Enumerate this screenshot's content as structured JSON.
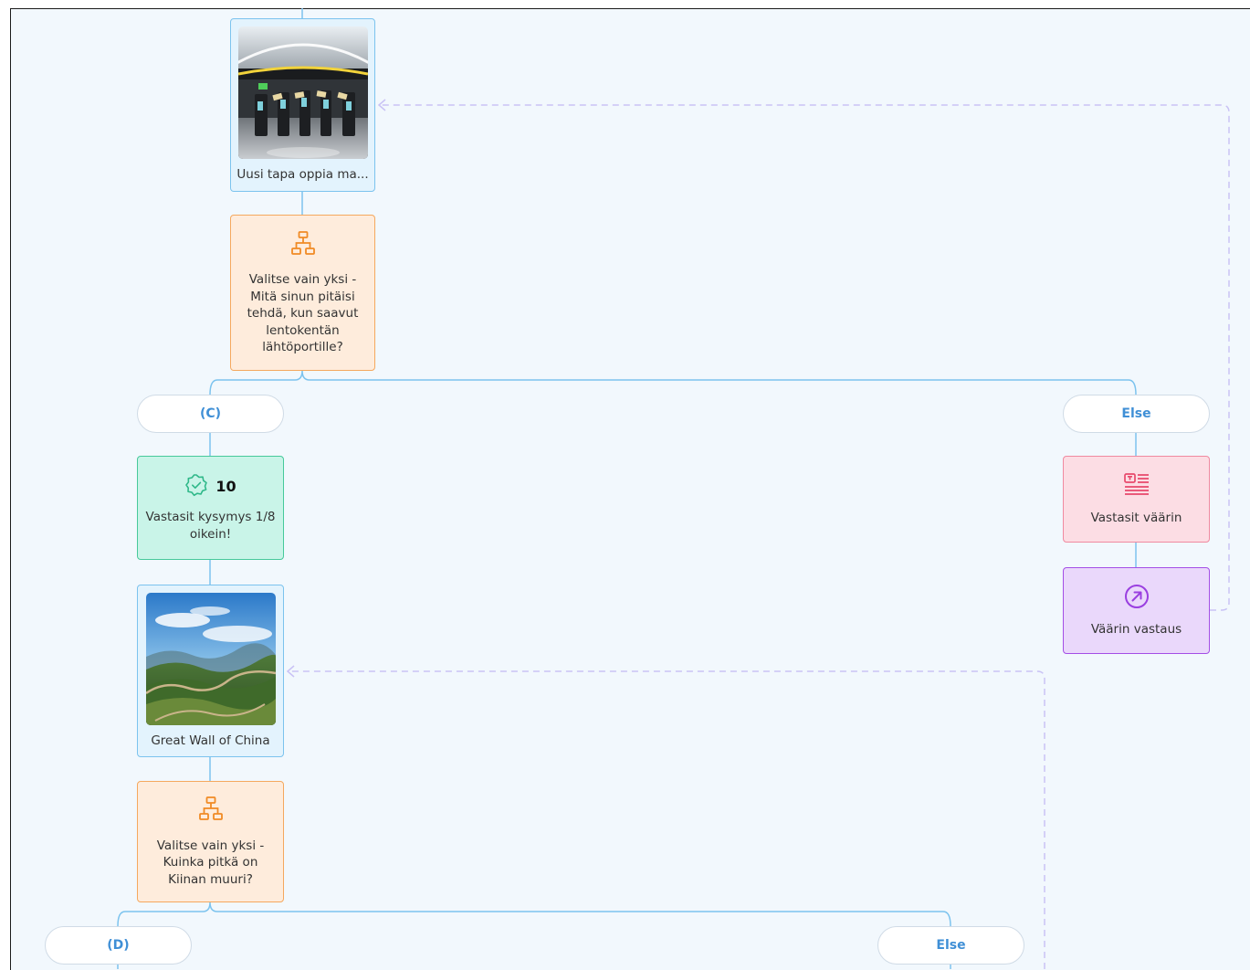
{
  "nodes": {
    "media_1": {
      "label": "Uusi tapa oppia ma...",
      "image": "airport gates with boarding kiosks"
    },
    "question_1": {
      "label": "Valitse vain yksi - Mitä sinun pitäisi tehdä, kun saavut lentokentän lähtöportille?",
      "icon": "sitemap-icon"
    },
    "branch_c": {
      "label": "(C)"
    },
    "branch_else_1": {
      "label": "Else"
    },
    "score_1": {
      "points": "10",
      "label": "Vastasit kysymys 1/8 oikein!",
      "icon": "badge-check-icon"
    },
    "text_1": {
      "label": "Vastasit väärin",
      "icon": "text-block-icon"
    },
    "jump_1": {
      "label": "Väärin vastaus",
      "icon": "arrow-up-right-circle-icon"
    },
    "media_2": {
      "label": "Great Wall of China",
      "image": "Great Wall of China over green mountains"
    },
    "question_2": {
      "label": "Valitse vain yksi - Kuinka pitkä on Kiinan muuri?",
      "icon": "sitemap-icon"
    },
    "branch_d": {
      "label": "(D)"
    },
    "branch_else_2": {
      "label": "Else"
    }
  },
  "colors": {
    "canvas": "#f2f8fd",
    "connector": "#7cc3ee",
    "jump_link": "#c9c2f5",
    "branch_label": "#3f8fd6",
    "question_icon": "#f08a24",
    "score_icon": "#2fb889",
    "text_icon": "#e8486b",
    "jump_icon": "#9a3fe0"
  }
}
